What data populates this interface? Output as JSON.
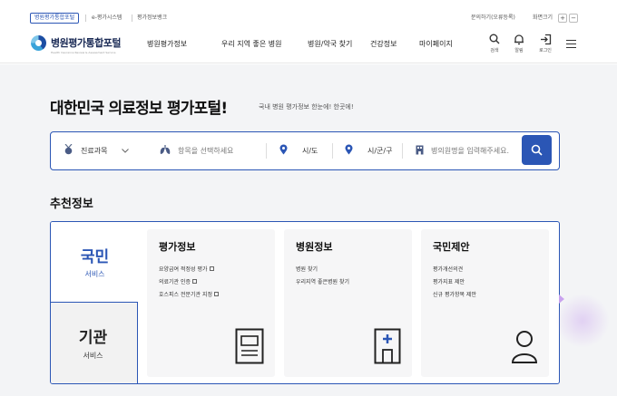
{
  "util": {
    "tab_portal": "병원평가통합포털",
    "tab_eval_system": "e-평가시스템",
    "tab_eval_bank": "평가정보뱅크",
    "inquiry": "문의하기(오류등록)",
    "zoom_label": "화면크기",
    "zoom_in": "+",
    "zoom_out": "−"
  },
  "header": {
    "logo_text": "병원평가통합포털",
    "logo_sub": "Health Insurance Review & Assessment Service",
    "nav": [
      "병원평가정보",
      "우리 지역 좋은 병원",
      "병원/약국 찾기",
      "건강정보",
      "마이페이지"
    ],
    "tools": [
      "검색",
      "알림",
      "로그인"
    ]
  },
  "hero": {
    "title": "대한민국 의료정보 평가포털!",
    "subtitle": "국내 병원 평가정보 한눈에! 한곳에!"
  },
  "search": {
    "dept_label": "진료과목",
    "item_placeholder": "항목을 선택하세요",
    "city_label": "시/도",
    "district_label": "시/군/구",
    "hospital_placeholder": "병의원명을 입력해주세요."
  },
  "recommend": {
    "title": "추천정보",
    "cat_public_big": "국민",
    "cat_public_small": "서비스",
    "cat_inst_big": "기관",
    "cat_inst_small": "서비스",
    "cards": [
      {
        "title": "평가정보",
        "items": [
          "요양급여 적정성 평가",
          "의료기관 인증",
          "호스피스 전문기관 지정"
        ]
      },
      {
        "title": "병원정보",
        "items": [
          "병원 찾기",
          "우리지역 좋은병원 찾기"
        ]
      },
      {
        "title": "국민제안",
        "items": [
          "평가개선의견",
          "평가지표 제안",
          "신규 평가항목 제안"
        ]
      }
    ]
  },
  "colors": {
    "accent": "#2b56b5",
    "hero_bg": "#f3f4f6"
  }
}
